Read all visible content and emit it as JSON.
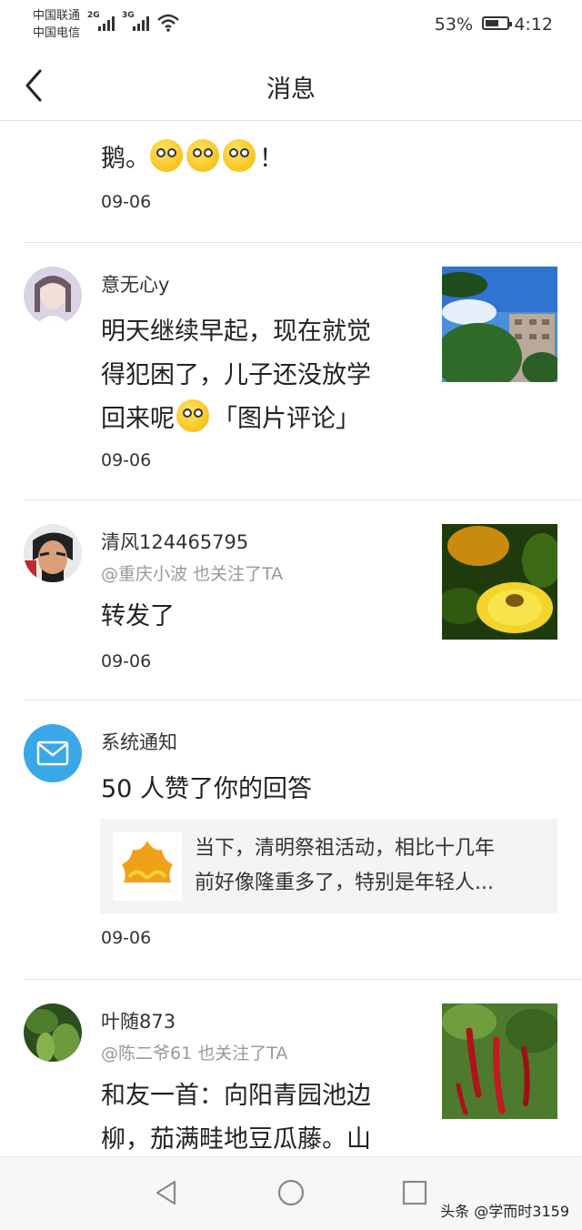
{
  "status_bar": {
    "carrier_1": "中国联通",
    "carrier_2": "中国电信",
    "signal_1": "2G",
    "signal_2": "3G",
    "battery": "53%",
    "time": "4:12"
  },
  "header": {
    "title": "消息"
  },
  "feed": {
    "partial": {
      "text": "鹅。",
      "suffix": "！",
      "date": "09-06"
    },
    "items": [
      {
        "name": "意无心y",
        "text_lines": [
          "明天继续早起，现在就觉",
          "得犯困了，儿子还没放学",
          "回来呢"
        ],
        "text_tail": "「图片评论」",
        "date": "09-06"
      },
      {
        "name": "清风124465795",
        "sub": "@重庆小波 也关注了TA",
        "text": "转发了",
        "date": "09-06"
      },
      {
        "name": "系统通知",
        "text": "50 人赞了你的回答",
        "card_lines": [
          "当下，清明祭祖活动，相比十几年",
          "前好像隆重多了，特别是年轻人..."
        ],
        "date": "09-06"
      },
      {
        "name": "叶随873",
        "sub": "@陈二爷61 也关注了TA",
        "text_lines": [
          "和友一首：向阳青园池边",
          "柳，茄满畦地豆瓜藤。山"
        ]
      }
    ]
  },
  "footer": {
    "watermark": "头条 @学而时3159"
  },
  "colors": {
    "accent_blue": "#3aa7e8",
    "text": "#222222",
    "muted": "#999999"
  }
}
